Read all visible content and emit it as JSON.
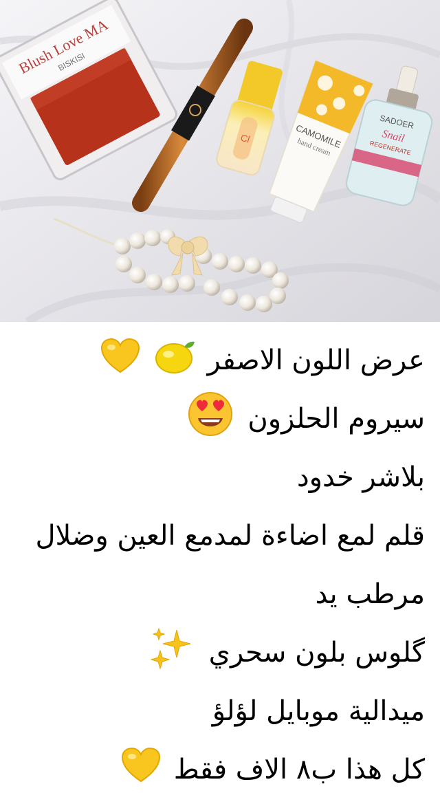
{
  "photo": {
    "blush_brand": "Blush Love MA",
    "blush_sub": "BISKISI",
    "gloss_text": "Cl",
    "cream_brand": "CAMOMILE",
    "cream_sub": "hand cream",
    "serum_brand": "SADOER",
    "serum_name": "Snail",
    "serum_sub": "REGENERATE"
  },
  "caption": {
    "lines": [
      {
        "text": "عرض اللون الاصفر",
        "emoji": [
          "lemon-icon",
          "yellow-heart-icon"
        ]
      },
      {
        "text": "سيروم الحلزون",
        "emoji": [
          "heart-eyes-icon"
        ]
      },
      {
        "text": "بلاشر خدود"
      },
      {
        "text": "قلم لمع اضاءة لمدمع العين وضلال"
      },
      {
        "text": "مرطب يد"
      },
      {
        "text": "گلوس بلون سحري",
        "emoji": [
          "sparkles-icon"
        ]
      },
      {
        "text": "ميدالية موبايل لؤلؤ"
      },
      {
        "text": "كل هذا ب٨ الاف فقط",
        "emoji": [
          "yellow-heart-icon"
        ]
      }
    ]
  }
}
